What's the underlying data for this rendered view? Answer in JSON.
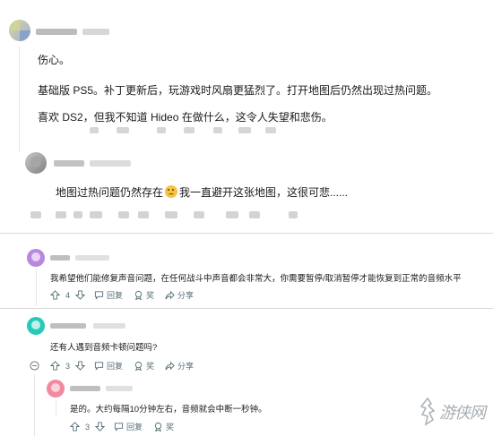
{
  "comments": {
    "c1": {
      "body_lines": [
        "伤心。",
        "基础版 PS5。补丁更新后，玩游戏时风扇更猛烈了。打开地图后仍然出现过热问题。",
        "喜欢 DS2，但我不知道 Hideo 在做什么，这令人失望和悲伤。"
      ]
    },
    "c2": {
      "body_before": "地图过热问题仍然存在",
      "emoji": "😢",
      "body_after": "我一直避开这张地图，这很可悲......"
    },
    "c3": {
      "body": "我希望他们能修复声音问题，在任何战斗中声音都会非常大，你需要暂停/取消暂停才能恢复到正常的音频水平",
      "votes": "4",
      "reply_label": "回复",
      "award_label": "奖",
      "share_label": "分享"
    },
    "c4": {
      "body": "还有人遇到音频卡顿问题吗?",
      "votes": "3",
      "reply_label": "回复",
      "award_label": "奖",
      "share_label": "分享"
    },
    "c5": {
      "body": "是的。大约每隔10分钟左右，音频就会中断一秒钟。",
      "votes": "3",
      "reply_label": "回复",
      "award_label": "奖"
    }
  },
  "watermark": {
    "text": "游侠网"
  },
  "colors": {
    "text": "#1a1a1b",
    "meta": "#576f76",
    "accent_purple": "#b887e0",
    "accent_teal": "#27c9b8",
    "accent_pink": "#f08aa0"
  }
}
